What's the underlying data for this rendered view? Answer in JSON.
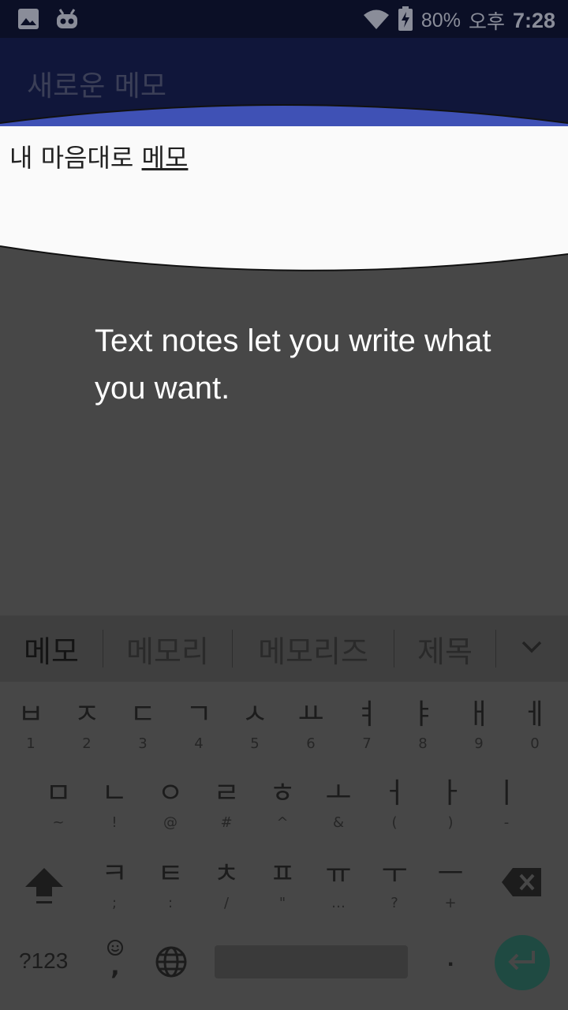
{
  "status_bar": {
    "battery_percent": "80%",
    "am_pm": "오후",
    "time": "7:28",
    "icons": [
      "image-icon",
      "android-debug-icon",
      "wifi-icon",
      "battery-charging-icon"
    ]
  },
  "toolbar": {
    "title": "새로운 메모"
  },
  "note": {
    "text_prefix": "내 마음대로 ",
    "text_composing": "메모"
  },
  "tutorial": {
    "message": "Text notes let you write what you want."
  },
  "suggestions": {
    "items": [
      "메모",
      "메모리",
      "메모리즈",
      "제목"
    ],
    "expand_icon": "chevron-down-icon"
  },
  "keyboard": {
    "row1": [
      {
        "main": "ㅂ",
        "sub": "1"
      },
      {
        "main": "ㅈ",
        "sub": "2"
      },
      {
        "main": "ㄷ",
        "sub": "3"
      },
      {
        "main": "ㄱ",
        "sub": "4"
      },
      {
        "main": "ㅅ",
        "sub": "5"
      },
      {
        "main": "ㅛ",
        "sub": "6"
      },
      {
        "main": "ㅕ",
        "sub": "7"
      },
      {
        "main": "ㅑ",
        "sub": "8"
      },
      {
        "main": "ㅐ",
        "sub": "9"
      },
      {
        "main": "ㅔ",
        "sub": "0"
      }
    ],
    "row2": [
      {
        "main": "ㅁ",
        "sub": "~"
      },
      {
        "main": "ㄴ",
        "sub": "!"
      },
      {
        "main": "ㅇ",
        "sub": "@"
      },
      {
        "main": "ㄹ",
        "sub": "#"
      },
      {
        "main": "ㅎ",
        "sub": "^"
      },
      {
        "main": "ㅗ",
        "sub": "&"
      },
      {
        "main": "ㅓ",
        "sub": "("
      },
      {
        "main": "ㅏ",
        "sub": ")"
      },
      {
        "main": "ㅣ",
        "sub": "-"
      }
    ],
    "row3": [
      {
        "main": "ㅋ",
        "sub": ";"
      },
      {
        "main": "ㅌ",
        "sub": ":"
      },
      {
        "main": "ㅊ",
        "sub": "/"
      },
      {
        "main": "ㅍ",
        "sub": "\""
      },
      {
        "main": "ㅠ",
        "sub": "…"
      },
      {
        "main": "ㅜ",
        "sub": "?"
      },
      {
        "main": "ㅡ",
        "sub": "+"
      }
    ],
    "symbols_label": "?123",
    "emoji_sub": ",",
    "period": ".",
    "icons": [
      "shift-icon",
      "backspace-icon",
      "emoji-icon",
      "globe-icon",
      "enter-icon"
    ]
  },
  "colors": {
    "toolbar_bg": "#10163a",
    "status_bg": "#0b0f26",
    "accent_blue": "#3f51b5",
    "enter_key": "#1f4a42",
    "overlay_dim": "#474747"
  }
}
